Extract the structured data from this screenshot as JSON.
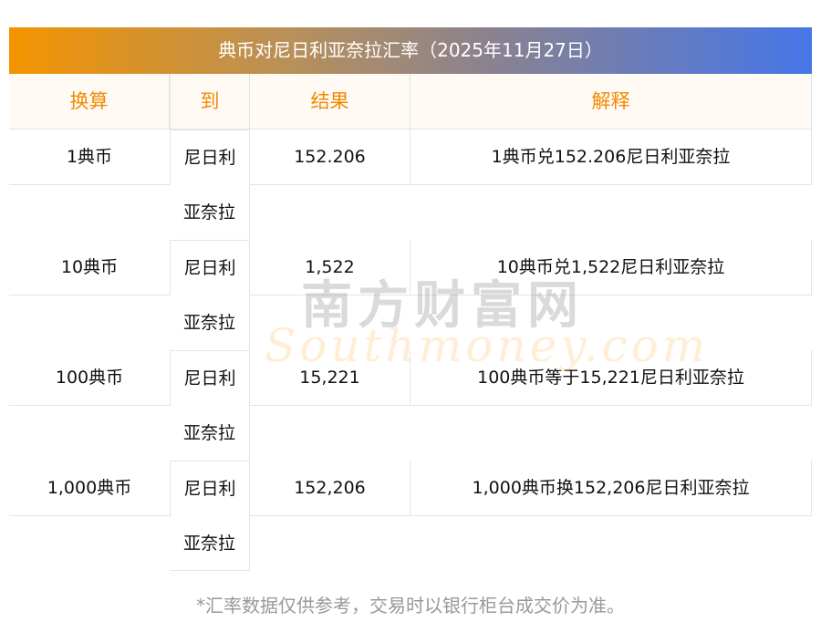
{
  "title": "典币对尼日利亚奈拉汇率（2025年11月27日）",
  "headers": [
    "换算",
    "到",
    "结果",
    "解释"
  ],
  "rows": [
    {
      "from": "1典币",
      "to_line1": "尼日利",
      "to_line2": "亚奈拉",
      "result": "152.206",
      "explain": "1典币兑152.206尼日利亚奈拉"
    },
    {
      "from": "10典币",
      "to_line1": "尼日利",
      "to_line2": "亚奈拉",
      "result": "1,522",
      "explain": "10典币兑1,522尼日利亚奈拉"
    },
    {
      "from": "100典币",
      "to_line1": "尼日利",
      "to_line2": "亚奈拉",
      "result": "15,221",
      "explain": "100典币等于15,221尼日利亚奈拉"
    },
    {
      "from": "1,000典币",
      "to_line1": "尼日利",
      "to_line2": "亚奈拉",
      "result": "152,206",
      "explain": "1,000典币换152,206尼日利亚奈拉"
    }
  ],
  "watermark": {
    "cn": "南方财富网",
    "en": "Southmoney.com"
  },
  "footnote": "*汇率数据仅供参考，交易时以银行柜台成交价为准。",
  "colors": {
    "header_text": "#f08a00",
    "gradient_start": "#f39400",
    "gradient_end": "#4676e8"
  }
}
